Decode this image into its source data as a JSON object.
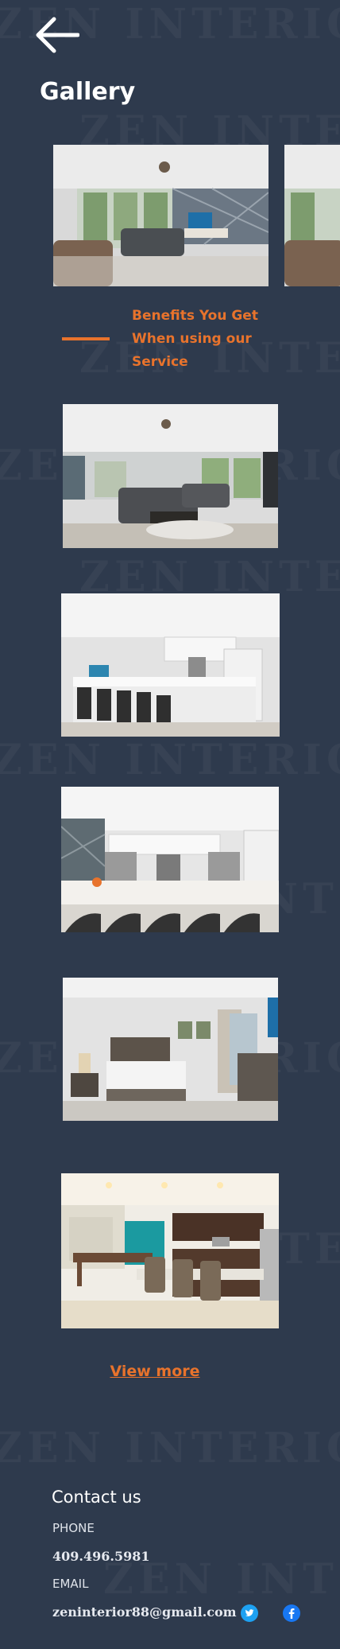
{
  "watermark_text": "ZEN INTERIOR",
  "header": {
    "back_icon": "arrow-left-icon",
    "title": "Gallery"
  },
  "benefits": {
    "text": "Benefits You Get When using our Service"
  },
  "gallery": {
    "photos": [
      "living-room-with-tv",
      "living-room-sectional-sofa",
      "kitchen-island-with-stools",
      "kitchen-counter-with-appliances",
      "bedroom-with-bed",
      "dining-area-and-kitchen"
    ]
  },
  "view_more": {
    "label": "View more"
  },
  "contact": {
    "title": "Contact us",
    "phone_label": "PHONE",
    "phone": "409.496.5981",
    "email_label": "EMAIL",
    "email": "zeninterior88@gmail.com",
    "social": [
      {
        "icon": "twitter-icon",
        "color": "#1da1f2"
      },
      {
        "icon": "facebook-icon",
        "color": "#1877f2"
      }
    ]
  },
  "colors": {
    "background": "#2e3a4d",
    "accent": "#e8732c"
  }
}
